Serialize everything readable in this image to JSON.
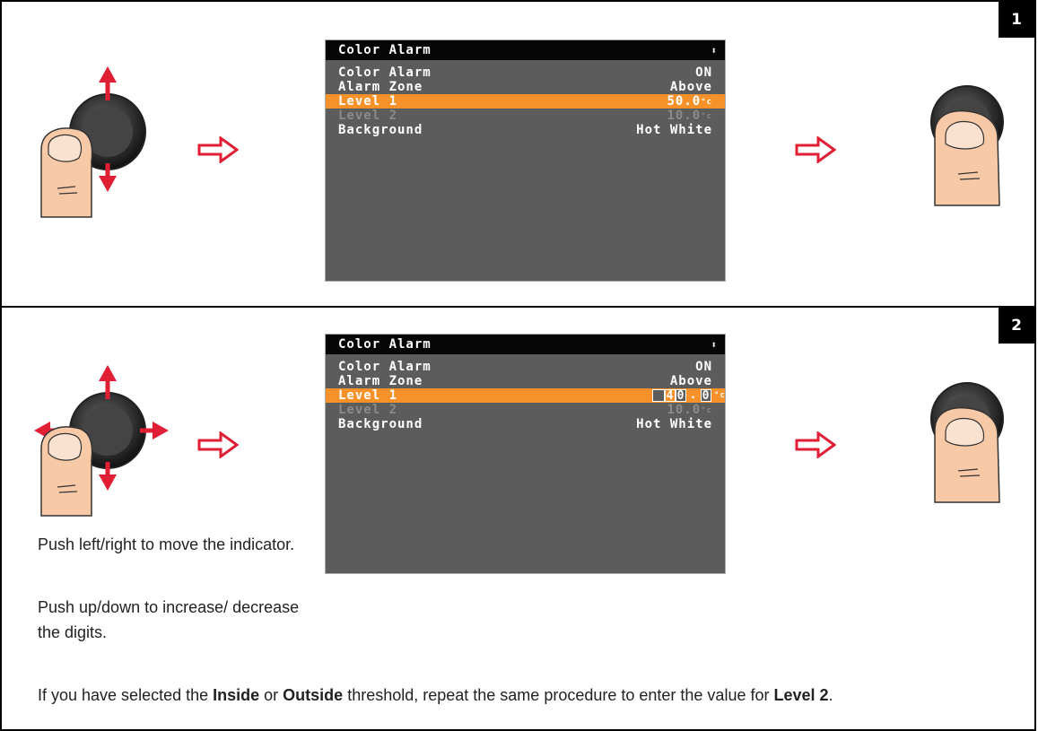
{
  "steps": [
    {
      "number": "1",
      "screen": {
        "title": "Color Alarm",
        "rows": [
          {
            "label": "Color Alarm",
            "value": "ON"
          },
          {
            "label": "Alarm Zone",
            "value": "Above"
          },
          {
            "label": "Level 1",
            "value": "50.0",
            "unit": "°c"
          },
          {
            "label": "Level 2",
            "value": "10.0",
            "unit": "°c"
          },
          {
            "label": "Background",
            "value": "Hot White"
          }
        ]
      }
    },
    {
      "number": "2",
      "screen": {
        "title": "Color Alarm",
        "rows": [
          {
            "label": "Color Alarm",
            "value": "ON"
          },
          {
            "label": "Alarm Zone",
            "value": "Above"
          },
          {
            "label": "Level 1",
            "edit_digits": [
              "",
              "4",
              "0",
              ".",
              "0"
            ],
            "unit": "°c"
          },
          {
            "label": "Level 2",
            "value": "10.0",
            "unit": "°c"
          },
          {
            "label": "Background",
            "value": "Hot White"
          }
        ]
      },
      "captions": [
        "Push left/right to move the indicator.",
        "Push up/down to increase/ decrease the digits."
      ]
    }
  ],
  "footnote": {
    "part1": "If you have selected the ",
    "inside": "Inside",
    "part2": " or ",
    "outside": "Outside",
    "part3": " threshold, repeat the same procedure to enter the value for ",
    "level2": "Level 2",
    "part4": "."
  },
  "colors": {
    "highlight": "#f7922a",
    "arrow": "#e01f35",
    "screen_bg": "#5c5c5c",
    "skin": "#f7c9a6"
  },
  "icons": [
    "joystick-icon",
    "thumb-icon",
    "direction-arrow-icon",
    "next-arrow-icon",
    "updown-icon"
  ]
}
